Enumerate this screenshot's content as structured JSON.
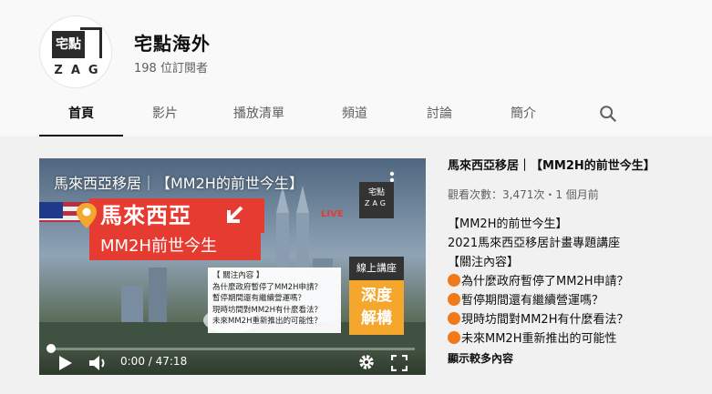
{
  "channel": {
    "name": "宅點海外",
    "subscribers": "198 位訂閱者",
    "logo_text": "宅點",
    "logo_sub": "ZAG"
  },
  "tabs": [
    {
      "label": "首頁",
      "active": true
    },
    {
      "label": "影片",
      "active": false
    },
    {
      "label": "播放清單",
      "active": false
    },
    {
      "label": "頻道",
      "active": false
    },
    {
      "label": "討論",
      "active": false
    },
    {
      "label": "簡介",
      "active": false
    }
  ],
  "search_icon": "search-icon",
  "player": {
    "title": "馬來西亞移居｜【MM2H的前世今生】",
    "thumb_headline": "馬來西亞",
    "thumb_subheadline": "MM2H前世今生",
    "live_label": "LIVE",
    "online_tag": "線上講座",
    "deep_tag": "深度\n解構",
    "deep_tag_line1": "深度",
    "deep_tag_line2": "解構",
    "notice_title": "【 關注內容 】",
    "notice_items": [
      "為什麼政府暫停了MM2H申請？",
      "暫停期間還有繼續營運嗎？",
      "現時坊間對MM2H有什麼看法？",
      "未來MM2H重新推出的可能性？"
    ],
    "time": "0:00 / 47:18",
    "watermark_text": "宅點",
    "watermark_sub": "ZAG",
    "progress": 0
  },
  "description": {
    "title": "馬來西亞移居｜【MM2H的前世今生】",
    "meta": "觀看次數：3,471次・1 個月前",
    "lines": [
      {
        "bullet": false,
        "text": "【MM2H的前世今生】"
      },
      {
        "bullet": false,
        "text": "2021馬來西亞移居計畫專題講座"
      },
      {
        "bullet": false,
        "text": "【關注內容】"
      },
      {
        "bullet": true,
        "text": "為什麼政府暫停了MM2H申請？"
      },
      {
        "bullet": true,
        "text": "暫停期間還有繼續營運嗎？"
      },
      {
        "bullet": true,
        "text": "現時坊間對MM2H有什麼看法？"
      },
      {
        "bullet": true,
        "text": "未來MM2H重新推出的可能性"
      }
    ],
    "show_more": "顯示較多內容"
  },
  "colors": {
    "accent_red": "#e63b30",
    "bullet_orange": "#f07a1a",
    "deep_orange": "#f4a72c"
  }
}
